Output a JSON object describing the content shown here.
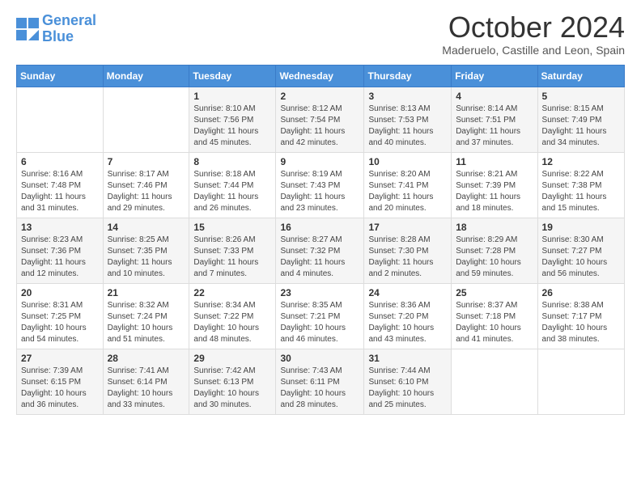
{
  "logo": {
    "line1": "General",
    "line2": "Blue"
  },
  "header": {
    "title": "October 2024",
    "location": "Maderuelo, Castille and Leon, Spain"
  },
  "weekdays": [
    "Sunday",
    "Monday",
    "Tuesday",
    "Wednesday",
    "Thursday",
    "Friday",
    "Saturday"
  ],
  "weeks": [
    [
      {
        "day": "",
        "info": ""
      },
      {
        "day": "",
        "info": ""
      },
      {
        "day": "1",
        "info": "Sunrise: 8:10 AM\nSunset: 7:56 PM\nDaylight: 11 hours and 45 minutes."
      },
      {
        "day": "2",
        "info": "Sunrise: 8:12 AM\nSunset: 7:54 PM\nDaylight: 11 hours and 42 minutes."
      },
      {
        "day": "3",
        "info": "Sunrise: 8:13 AM\nSunset: 7:53 PM\nDaylight: 11 hours and 40 minutes."
      },
      {
        "day": "4",
        "info": "Sunrise: 8:14 AM\nSunset: 7:51 PM\nDaylight: 11 hours and 37 minutes."
      },
      {
        "day": "5",
        "info": "Sunrise: 8:15 AM\nSunset: 7:49 PM\nDaylight: 11 hours and 34 minutes."
      }
    ],
    [
      {
        "day": "6",
        "info": "Sunrise: 8:16 AM\nSunset: 7:48 PM\nDaylight: 11 hours and 31 minutes."
      },
      {
        "day": "7",
        "info": "Sunrise: 8:17 AM\nSunset: 7:46 PM\nDaylight: 11 hours and 29 minutes."
      },
      {
        "day": "8",
        "info": "Sunrise: 8:18 AM\nSunset: 7:44 PM\nDaylight: 11 hours and 26 minutes."
      },
      {
        "day": "9",
        "info": "Sunrise: 8:19 AM\nSunset: 7:43 PM\nDaylight: 11 hours and 23 minutes."
      },
      {
        "day": "10",
        "info": "Sunrise: 8:20 AM\nSunset: 7:41 PM\nDaylight: 11 hours and 20 minutes."
      },
      {
        "day": "11",
        "info": "Sunrise: 8:21 AM\nSunset: 7:39 PM\nDaylight: 11 hours and 18 minutes."
      },
      {
        "day": "12",
        "info": "Sunrise: 8:22 AM\nSunset: 7:38 PM\nDaylight: 11 hours and 15 minutes."
      }
    ],
    [
      {
        "day": "13",
        "info": "Sunrise: 8:23 AM\nSunset: 7:36 PM\nDaylight: 11 hours and 12 minutes."
      },
      {
        "day": "14",
        "info": "Sunrise: 8:25 AM\nSunset: 7:35 PM\nDaylight: 11 hours and 10 minutes."
      },
      {
        "day": "15",
        "info": "Sunrise: 8:26 AM\nSunset: 7:33 PM\nDaylight: 11 hours and 7 minutes."
      },
      {
        "day": "16",
        "info": "Sunrise: 8:27 AM\nSunset: 7:32 PM\nDaylight: 11 hours and 4 minutes."
      },
      {
        "day": "17",
        "info": "Sunrise: 8:28 AM\nSunset: 7:30 PM\nDaylight: 11 hours and 2 minutes."
      },
      {
        "day": "18",
        "info": "Sunrise: 8:29 AM\nSunset: 7:28 PM\nDaylight: 10 hours and 59 minutes."
      },
      {
        "day": "19",
        "info": "Sunrise: 8:30 AM\nSunset: 7:27 PM\nDaylight: 10 hours and 56 minutes."
      }
    ],
    [
      {
        "day": "20",
        "info": "Sunrise: 8:31 AM\nSunset: 7:25 PM\nDaylight: 10 hours and 54 minutes."
      },
      {
        "day": "21",
        "info": "Sunrise: 8:32 AM\nSunset: 7:24 PM\nDaylight: 10 hours and 51 minutes."
      },
      {
        "day": "22",
        "info": "Sunrise: 8:34 AM\nSunset: 7:22 PM\nDaylight: 10 hours and 48 minutes."
      },
      {
        "day": "23",
        "info": "Sunrise: 8:35 AM\nSunset: 7:21 PM\nDaylight: 10 hours and 46 minutes."
      },
      {
        "day": "24",
        "info": "Sunrise: 8:36 AM\nSunset: 7:20 PM\nDaylight: 10 hours and 43 minutes."
      },
      {
        "day": "25",
        "info": "Sunrise: 8:37 AM\nSunset: 7:18 PM\nDaylight: 10 hours and 41 minutes."
      },
      {
        "day": "26",
        "info": "Sunrise: 8:38 AM\nSunset: 7:17 PM\nDaylight: 10 hours and 38 minutes."
      }
    ],
    [
      {
        "day": "27",
        "info": "Sunrise: 7:39 AM\nSunset: 6:15 PM\nDaylight: 10 hours and 36 minutes."
      },
      {
        "day": "28",
        "info": "Sunrise: 7:41 AM\nSunset: 6:14 PM\nDaylight: 10 hours and 33 minutes."
      },
      {
        "day": "29",
        "info": "Sunrise: 7:42 AM\nSunset: 6:13 PM\nDaylight: 10 hours and 30 minutes."
      },
      {
        "day": "30",
        "info": "Sunrise: 7:43 AM\nSunset: 6:11 PM\nDaylight: 10 hours and 28 minutes."
      },
      {
        "day": "31",
        "info": "Sunrise: 7:44 AM\nSunset: 6:10 PM\nDaylight: 10 hours and 25 minutes."
      },
      {
        "day": "",
        "info": ""
      },
      {
        "day": "",
        "info": ""
      }
    ]
  ]
}
